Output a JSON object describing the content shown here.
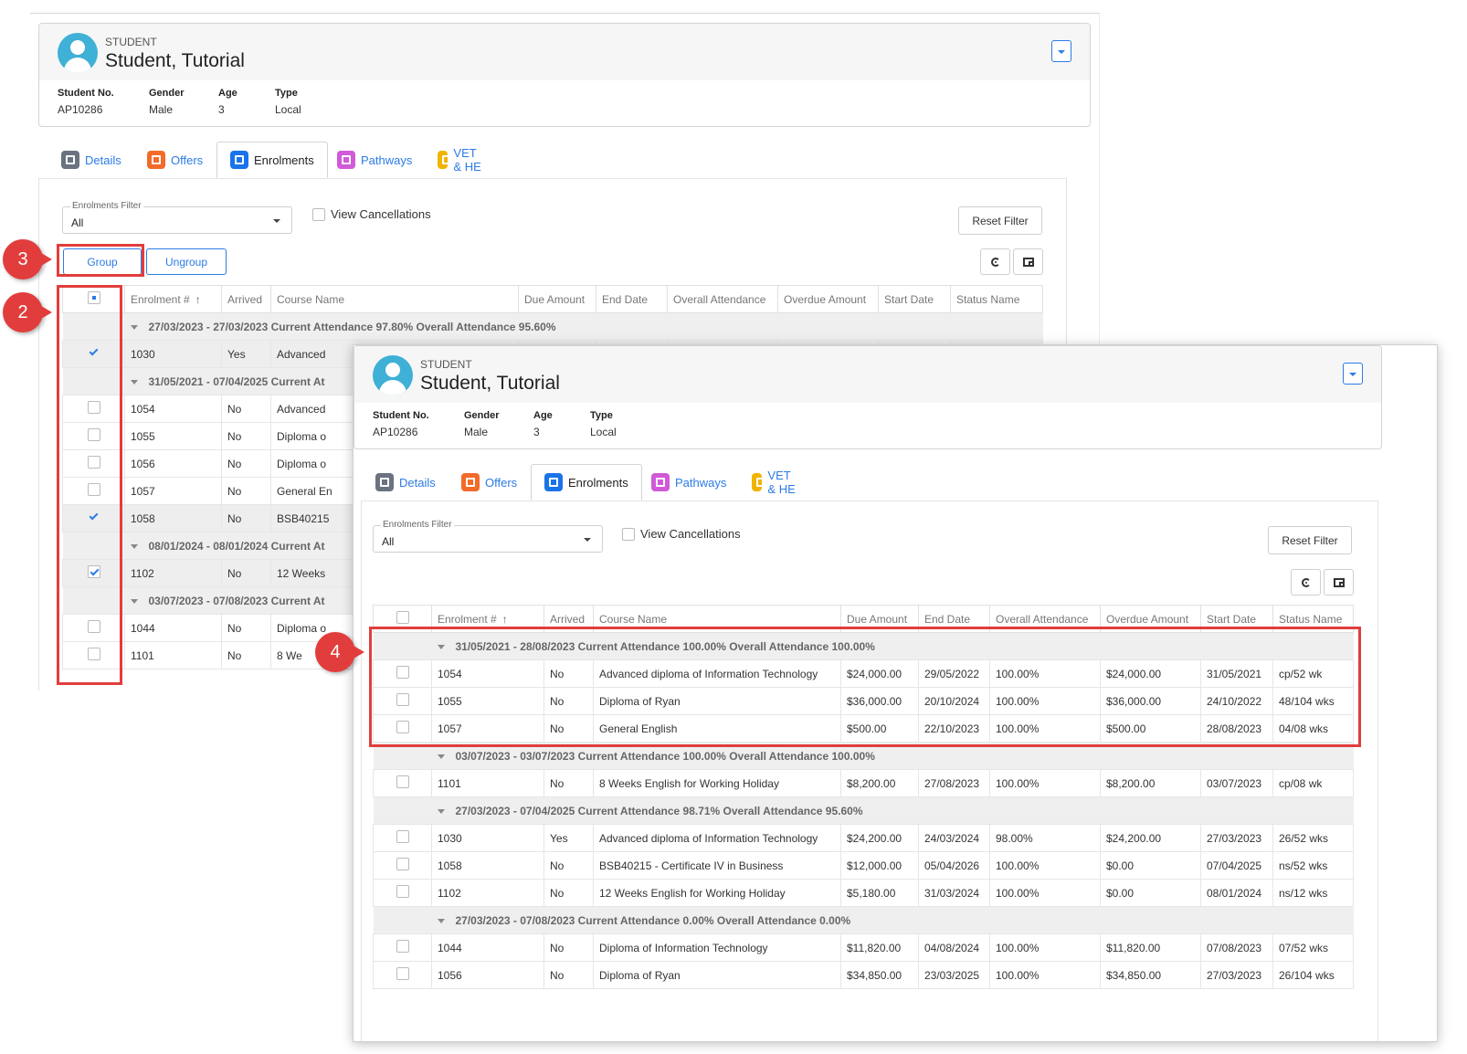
{
  "student": {
    "label": "STUDENT",
    "name": "Student, Tutorial",
    "fields": [
      {
        "label": "Student No.",
        "value": "AP10286"
      },
      {
        "label": "Gender",
        "value": "Male"
      },
      {
        "label": "Age",
        "value": "3"
      },
      {
        "label": "Type",
        "value": "Local"
      }
    ]
  },
  "tabs": [
    {
      "label": "Details",
      "icon": "details-icon"
    },
    {
      "label": "Offers",
      "icon": "offers-icon"
    },
    {
      "label": "Enrolments",
      "icon": "enrolments-icon",
      "active": true
    },
    {
      "label": "Pathways",
      "icon": "pathways-icon"
    },
    {
      "label": "VET & HE",
      "icon": "vet-he-icon"
    }
  ],
  "filter": {
    "label": "Enrolments Filter",
    "value": "All"
  },
  "view_cancellations": "View Cancellations",
  "reset_filter": "Reset Filter",
  "group_button": "Group",
  "ungroup_button": "Ungroup",
  "columns": [
    "Enrolment #",
    "Arrived",
    "Course Name",
    "Due Amount",
    "End Date",
    "Overall Attendance",
    "Overdue Amount",
    "Start Date",
    "Status Name"
  ],
  "sort_indicator": "↑",
  "back_grid": {
    "rows": [
      {
        "group": "27/03/2023 - 27/03/2023 Current Attendance 97.80% Overall Attendance 95.60%"
      },
      {
        "checked": "check",
        "cells": [
          "1030",
          "Yes",
          "Advanced"
        ],
        "sel": true
      },
      {
        "group": "31/05/2021 - 07/04/2025 Current At"
      },
      {
        "cells": [
          "1054",
          "No",
          "Advanced"
        ]
      },
      {
        "cells": [
          "1055",
          "No",
          "Diploma o"
        ]
      },
      {
        "cells": [
          "1056",
          "No",
          "Diploma o"
        ]
      },
      {
        "cells": [
          "1057",
          "No",
          "General En"
        ]
      },
      {
        "checked": "check",
        "cells": [
          "1058",
          "No",
          "BSB40215"
        ],
        "sel": true
      },
      {
        "group": "08/01/2024 - 08/01/2024 Current At"
      },
      {
        "checked": "box",
        "cells": [
          "1102",
          "No",
          "12 Weeks"
        ],
        "sel": true
      },
      {
        "group": "03/07/2023 - 07/08/2023 Current At"
      },
      {
        "cells": [
          "1044",
          "No",
          "Diploma o"
        ]
      },
      {
        "cells": [
          "1101",
          "No",
          "8 We"
        ]
      }
    ]
  },
  "front_grid": {
    "rows": [
      {
        "group": "31/05/2021 - 28/08/2023 Current Attendance 100.00% Overall Attendance 100.00%"
      },
      {
        "cells": [
          "1054",
          "No",
          "Advanced diploma of Information Technology",
          "$24,000.00",
          "29/05/2022",
          "100.00%",
          "$24,000.00",
          "31/05/2021",
          "cp/52 wk"
        ]
      },
      {
        "cells": [
          "1055",
          "No",
          "Diploma of Ryan",
          "$36,000.00",
          "20/10/2024",
          "100.00%",
          "$36,000.00",
          "24/10/2022",
          "48/104 wks"
        ]
      },
      {
        "cells": [
          "1057",
          "No",
          "General English",
          "$500.00",
          "22/10/2023",
          "100.00%",
          "$500.00",
          "28/08/2023",
          "04/08 wks"
        ]
      },
      {
        "group": "03/07/2023 - 03/07/2023 Current Attendance 100.00% Overall Attendance 100.00%"
      },
      {
        "cells": [
          "1101",
          "No",
          "8 Weeks English for Working Holiday",
          "$8,200.00",
          "27/08/2023",
          "100.00%",
          "$8,200.00",
          "03/07/2023",
          "cp/08 wk"
        ]
      },
      {
        "group": "27/03/2023 - 07/04/2025 Current Attendance 98.71% Overall Attendance 95.60%"
      },
      {
        "cells": [
          "1030",
          "Yes",
          "Advanced diploma of Information Technology",
          "$24,200.00",
          "24/03/2024",
          "98.00%",
          "$24,200.00",
          "27/03/2023",
          "26/52 wks"
        ]
      },
      {
        "cells": [
          "1058",
          "No",
          "BSB40215 - Certificate IV in Business",
          "$12,000.00",
          "05/04/2026",
          "100.00%",
          "$0.00",
          "07/04/2025",
          "ns/52 wks"
        ]
      },
      {
        "cells": [
          "1102",
          "No",
          "12 Weeks English for Working Holiday",
          "$5,180.00",
          "31/03/2024",
          "100.00%",
          "$0.00",
          "08/01/2024",
          "ns/12 wks"
        ]
      },
      {
        "group": "27/03/2023 - 07/08/2023 Current Attendance 0.00% Overall Attendance 0.00%"
      },
      {
        "cells": [
          "1044",
          "No",
          "Diploma of Information Technology",
          "$11,820.00",
          "04/08/2024",
          "100.00%",
          "$11,820.00",
          "07/08/2023",
          "07/52 wks"
        ]
      },
      {
        "cells": [
          "1056",
          "No",
          "Diploma of Ryan",
          "$34,850.00",
          "23/03/2025",
          "100.00%",
          "$34,850.00",
          "27/03/2023",
          "26/104 wks"
        ]
      }
    ]
  },
  "callouts": [
    "3",
    "2",
    "4"
  ],
  "highlight_color": "#e23d3d",
  "accent_color": "#2c7be5"
}
